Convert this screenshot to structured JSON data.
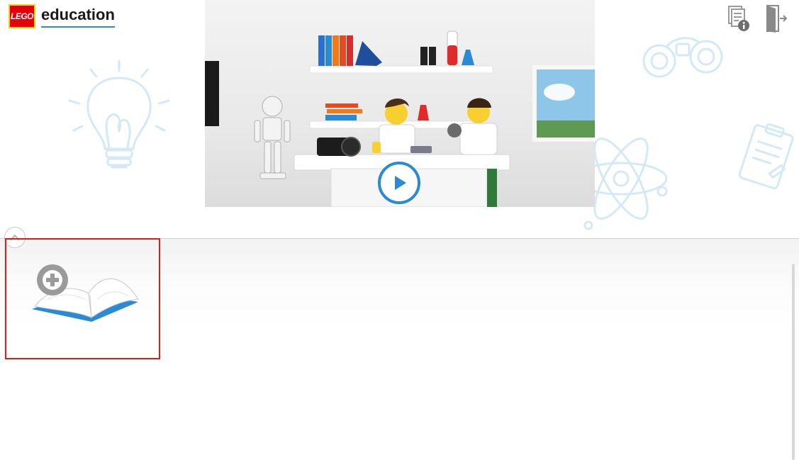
{
  "header": {
    "logo_badge_text": "LEGO",
    "logo_word": "education"
  },
  "top_icons": [
    {
      "name": "document-info-icon"
    },
    {
      "name": "exit-door-icon"
    }
  ],
  "hero": {
    "play_label": ""
  },
  "projects": {
    "new_project_icon": "open-book-plus-icon"
  },
  "colors": {
    "accent": "#2a8ad4",
    "lego_red": "#e3000b",
    "lego_yellow": "#f7d100",
    "highlight_border": "#e01b1b"
  }
}
